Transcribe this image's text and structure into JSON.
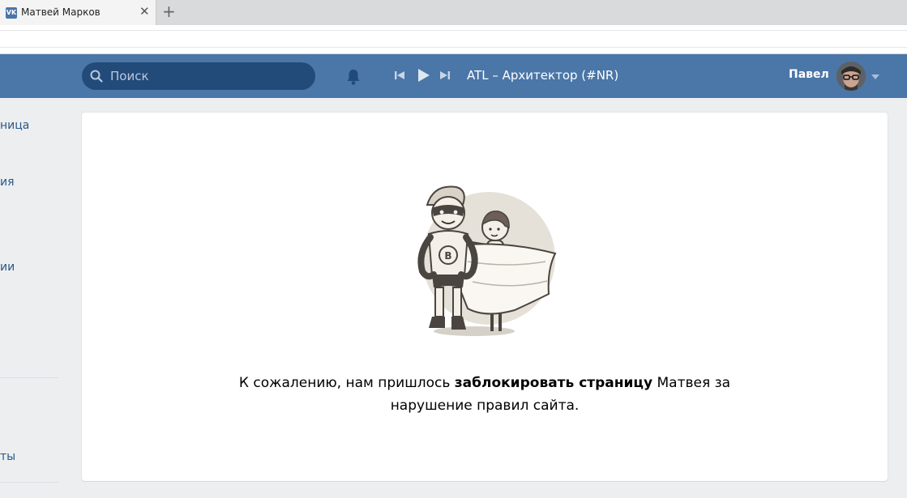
{
  "browser": {
    "tab_title": "Матвей Марков",
    "tab_favicon": "VK",
    "close_glyph": "✕",
    "new_tab_glyph": "+"
  },
  "header": {
    "search_placeholder": "Поиск",
    "player": {
      "track": "ATL – Архитектор (#NR)"
    },
    "user_name": "Павел",
    "colors": {
      "bar": "#4a76a8",
      "search_bg": "#224b7a"
    }
  },
  "sidebar": {
    "items": [
      "ница",
      "ия",
      "ии",
      "ты"
    ]
  },
  "content": {
    "message_part1": "К сожалению, нам пришлось ",
    "message_bold": "заблокировать страницу",
    "message_part2": " Матвея за нарушение правил сайта.",
    "illustration": "blocked-superhero-illustration"
  }
}
